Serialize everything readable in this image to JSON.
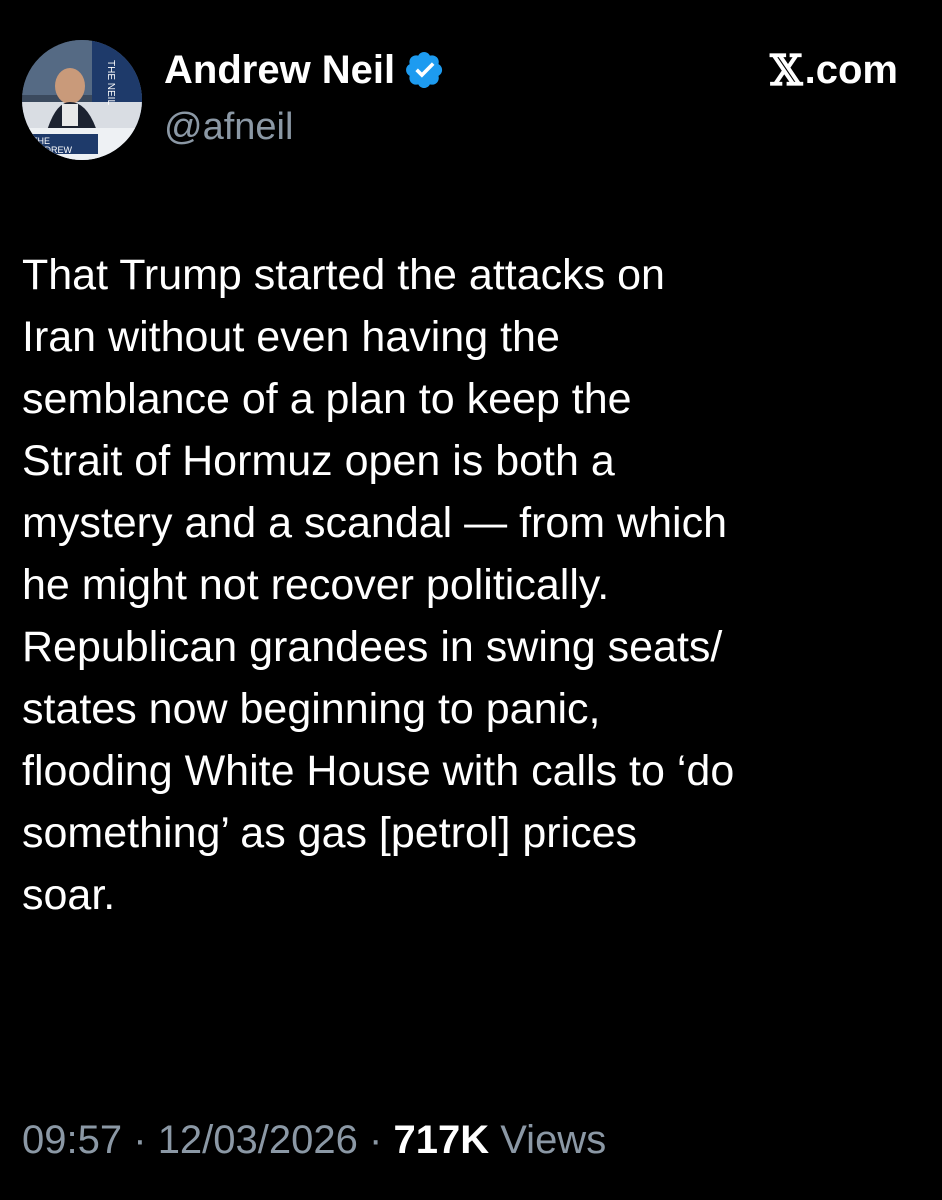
{
  "author": {
    "display_name": "Andrew Neil",
    "handle": "@afneil",
    "verified": true,
    "avatar_overlay_text": "THE ANDREW NEIL"
  },
  "brand": {
    "site_mark": "𝕏",
    "site_suffix": ".com"
  },
  "tweet": {
    "lines": [
      "That Trump started the attacks on",
      "Iran without even having the",
      "semblance of a plan to keep the",
      "Strait of Hormuz open is both a",
      "mystery and a scandal — from which",
      "he might not recover politically.",
      "Republican grandees in swing seats/",
      "states now beginning to panic,",
      "flooding White House with calls to ‘do",
      "something’ as gas [petrol] prices",
      "soar."
    ]
  },
  "meta": {
    "time": "09:57",
    "separator": "·",
    "date": "12/03/2026",
    "views_count": "717K",
    "views_label": "Views"
  },
  "colors": {
    "background": "#000000",
    "text_primary": "#ffffff",
    "text_secondary": "#8b98a5",
    "verified_badge": "#1d9bf0"
  },
  "icons": {
    "verified": "verified-badge-icon",
    "avatar": "profile-photo"
  }
}
